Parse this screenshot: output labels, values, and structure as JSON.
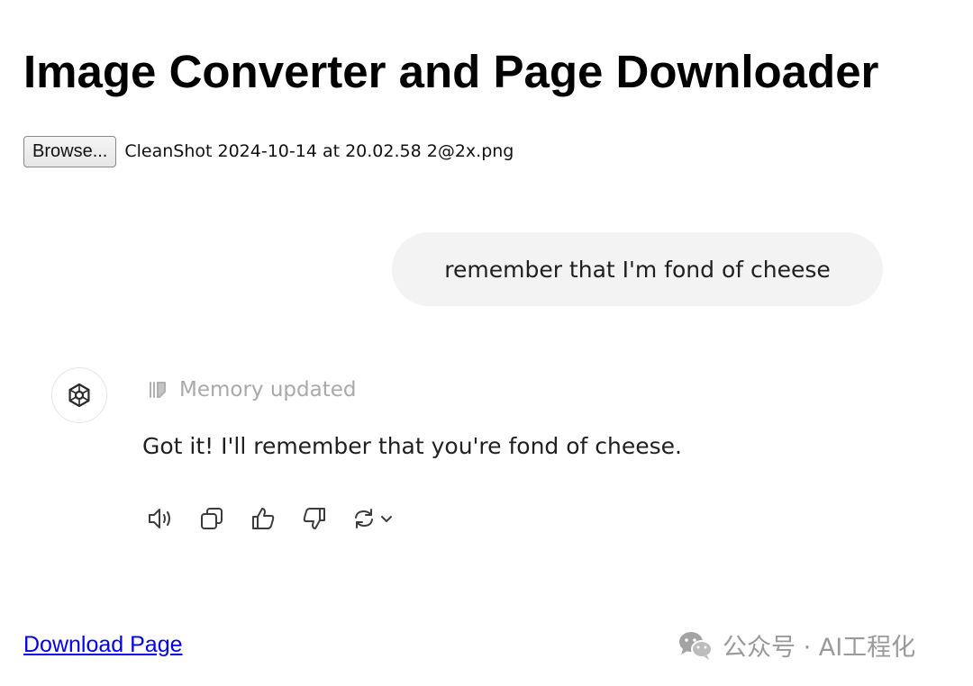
{
  "page": {
    "title": "Image Converter and Page Downloader"
  },
  "file_input": {
    "button_label": "Browse...",
    "file_name": "CleanShot 2024-10-14 at 20.02.58 2@2x.png"
  },
  "chat": {
    "user_message": "remember that I'm fond of cheese",
    "memory_status": "Memory updated",
    "assistant_message": "Got it! I'll remember that you're fond of cheese.",
    "actions": [
      {
        "icon": "speaker-icon"
      },
      {
        "icon": "copy-icon"
      },
      {
        "icon": "thumbs-up-icon"
      },
      {
        "icon": "thumbs-down-icon"
      },
      {
        "icon": "regenerate-icon"
      }
    ]
  },
  "footer": {
    "download_link": "Download Page",
    "watermark": "公众号 · AI工程化"
  },
  "colors": {
    "link": "#0000ee",
    "bubble_bg": "#f3f3f3",
    "muted_text": "#a9a9a9"
  }
}
